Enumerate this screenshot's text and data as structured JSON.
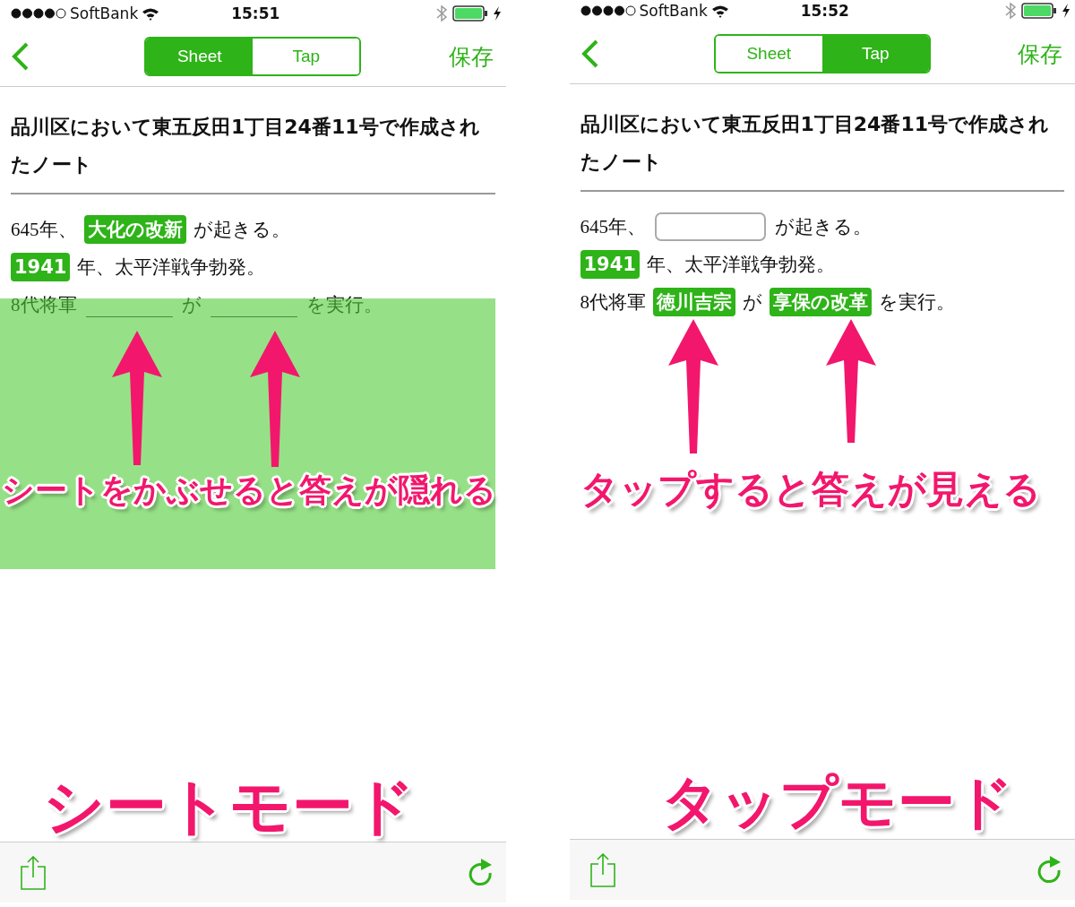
{
  "screens": [
    {
      "status_bar": {
        "carrier": "SoftBank",
        "time": "15:51"
      },
      "nav": {
        "tabs": [
          {
            "label": "Sheet",
            "selected": true
          },
          {
            "label": "Tap",
            "selected": false
          }
        ],
        "save": "保存"
      },
      "note": {
        "title": "品川区において東五反田1丁目24番11号で作成されたノート",
        "sheet_covered": true,
        "lines": [
          {
            "segments": [
              {
                "kind": "text",
                "text": "645年、"
              },
              {
                "kind": "answer",
                "text": "大化の改新"
              },
              {
                "kind": "text",
                "text": "が起きる。"
              }
            ]
          },
          {
            "segments": [
              {
                "kind": "answer",
                "text": "1941"
              },
              {
                "kind": "text",
                "text": "年、太平洋戦争勃発。"
              }
            ]
          },
          {
            "segments": [
              {
                "kind": "text",
                "text": "8代将軍"
              },
              {
                "kind": "blank"
              },
              {
                "kind": "text",
                "text": "が"
              },
              {
                "kind": "blank"
              },
              {
                "kind": "text",
                "text": "を実行。"
              }
            ]
          }
        ]
      },
      "caption": "シートをかぶせると答えが隠れる",
      "mode_label": "シートモード"
    },
    {
      "status_bar": {
        "carrier": "SoftBank",
        "time": "15:52"
      },
      "nav": {
        "tabs": [
          {
            "label": "Sheet",
            "selected": false
          },
          {
            "label": "Tap",
            "selected": true
          }
        ],
        "save": "保存"
      },
      "note": {
        "title": "品川区において東五反田1丁目24番11号で作成されたノート",
        "sheet_covered": false,
        "lines": [
          {
            "segments": [
              {
                "kind": "text",
                "text": "645年、"
              },
              {
                "kind": "input"
              },
              {
                "kind": "text",
                "text": "が起きる。"
              }
            ]
          },
          {
            "segments": [
              {
                "kind": "answer",
                "text": "1941"
              },
              {
                "kind": "text",
                "text": "年、太平洋戦争勃発。"
              }
            ]
          },
          {
            "segments": [
              {
                "kind": "text",
                "text": "8代将軍"
              },
              {
                "kind": "answer",
                "text": "徳川吉宗"
              },
              {
                "kind": "text",
                "text": "が"
              },
              {
                "kind": "answer",
                "text": "享保の改革"
              },
              {
                "kind": "text",
                "text": "を実行。"
              }
            ]
          }
        ]
      },
      "caption": "タップすると答えが見える",
      "mode_label": "タップモード"
    }
  ]
}
